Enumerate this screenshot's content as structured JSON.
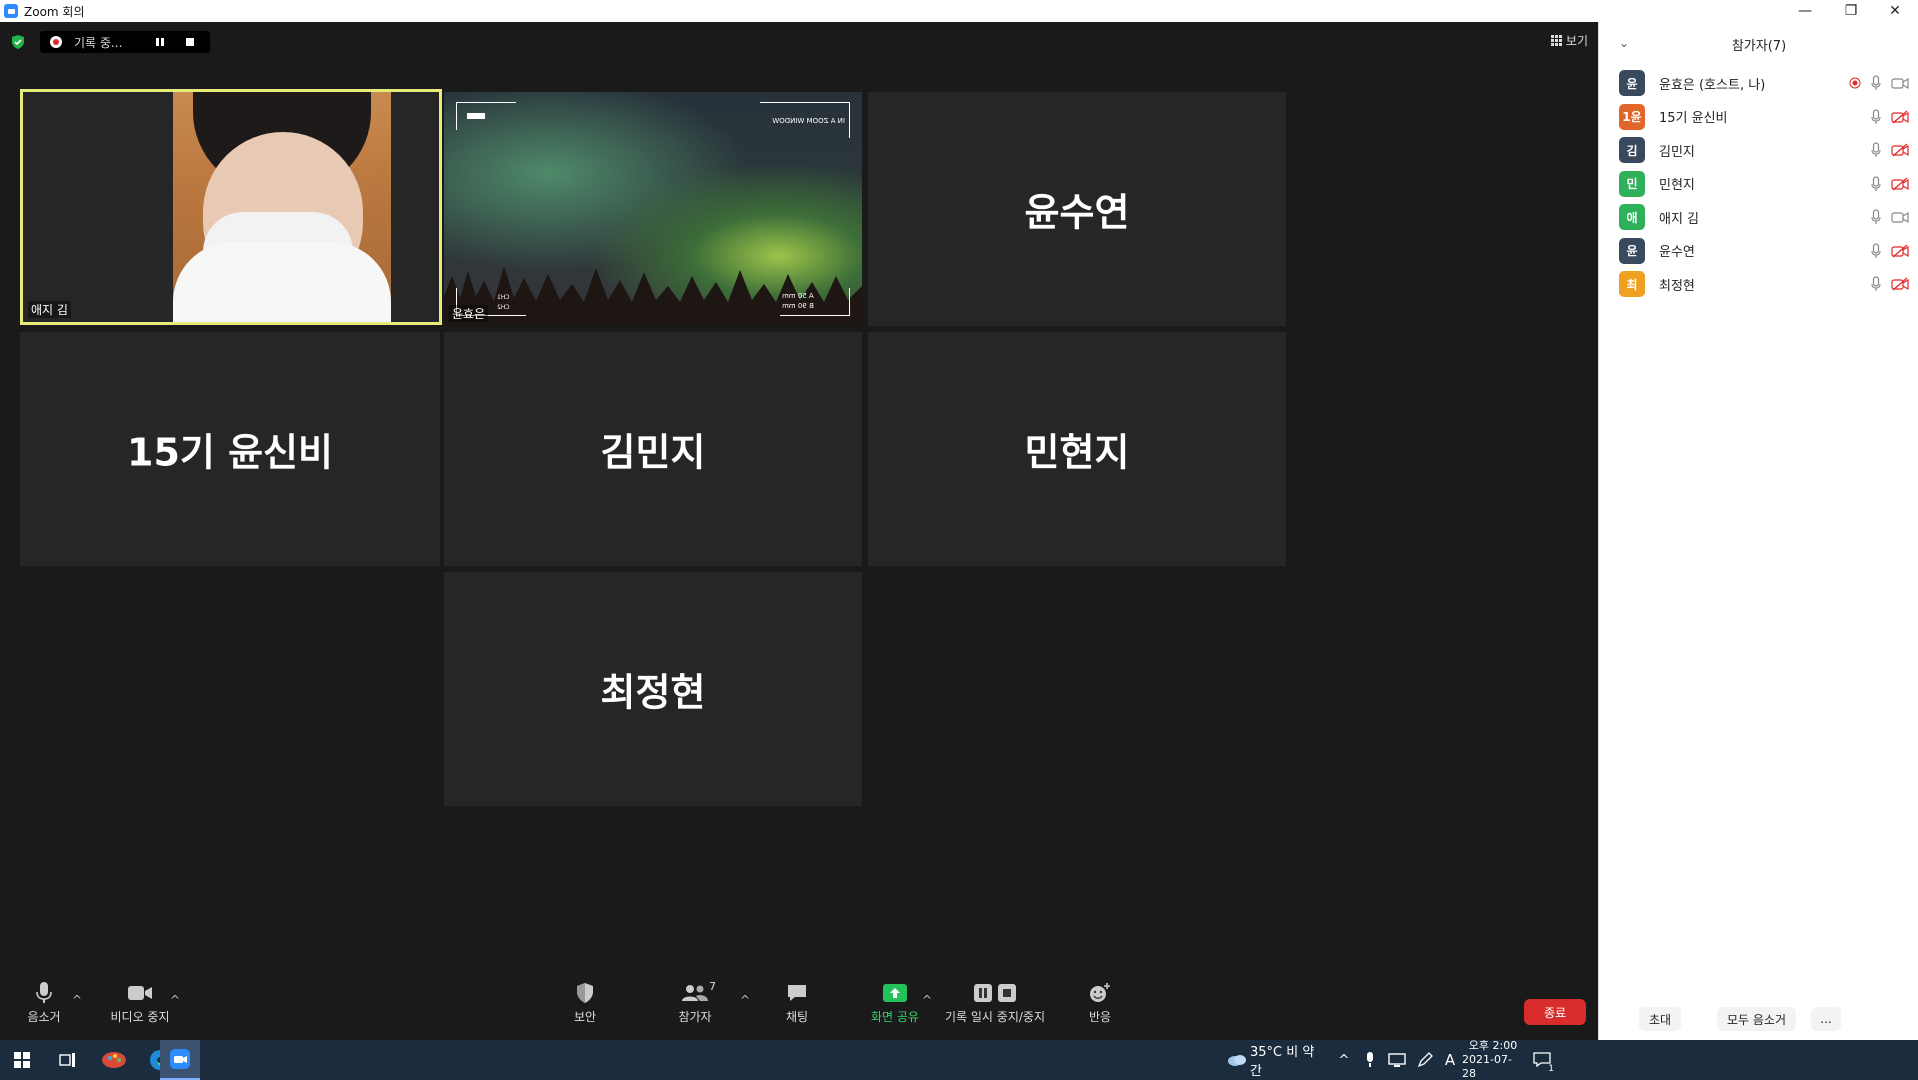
{
  "window": {
    "title": "Zoom 회의"
  },
  "topbar": {
    "recording_label": "기록 중...",
    "view_label": "보기"
  },
  "tiles": [
    {
      "name": "애지 김",
      "type": "video",
      "active": true
    },
    {
      "name": "윤효은",
      "type": "video-aurora"
    },
    {
      "name": "윤수연",
      "type": "name"
    },
    {
      "name": "15기 윤신비",
      "type": "name"
    },
    {
      "name": "김민지",
      "type": "name"
    },
    {
      "name": "민현지",
      "type": "name"
    },
    {
      "name": "최정현",
      "type": "name"
    }
  ],
  "video_overlay": {
    "top_right": "IN A ZOOM WINDOW",
    "ch1": "CH1",
    "ch2": "CH2",
    "lens_a": "A 50 mm",
    "lens_b": "B 90 mm"
  },
  "toolbar": {
    "mute": "음소거",
    "stop_video": "비디오 중지",
    "security": "보안",
    "participants": "참가자",
    "participants_count": "7",
    "chat": "채팅",
    "share": "화면 공유",
    "record": "기록 일시 중지/중지",
    "reactions": "반응",
    "end": "종료"
  },
  "panel": {
    "title": "참가자(7)",
    "participants": [
      {
        "initial": "윤",
        "name": "윤효은 (호스트, 나)",
        "color": "#3a4a5e",
        "recording": true,
        "video_off": false
      },
      {
        "initial": "1윤",
        "name": "15기 윤신비",
        "color": "#e0662a",
        "recording": false,
        "video_off": true
      },
      {
        "initial": "김",
        "name": "김민지",
        "color": "#3a4a5e",
        "recording": false,
        "video_off": true
      },
      {
        "initial": "민",
        "name": "민현지",
        "color": "#2fb05a",
        "recording": false,
        "video_off": true
      },
      {
        "initial": "애",
        "name": "애지 김",
        "color": "#2fb05a",
        "recording": false,
        "video_off": false
      },
      {
        "initial": "윤",
        "name": "윤수연",
        "color": "#3a4a5e",
        "recording": false,
        "video_off": true
      },
      {
        "initial": "최",
        "name": "최정현",
        "color": "#f0a020",
        "recording": false,
        "video_off": true
      }
    ],
    "invite": "초대",
    "mute_all": "모두 음소거",
    "more": "..."
  },
  "taskbar": {
    "weather": "35°C  비 약간",
    "time": "오후 2:00",
    "date": "2021-07-28",
    "notification_count": "1"
  }
}
